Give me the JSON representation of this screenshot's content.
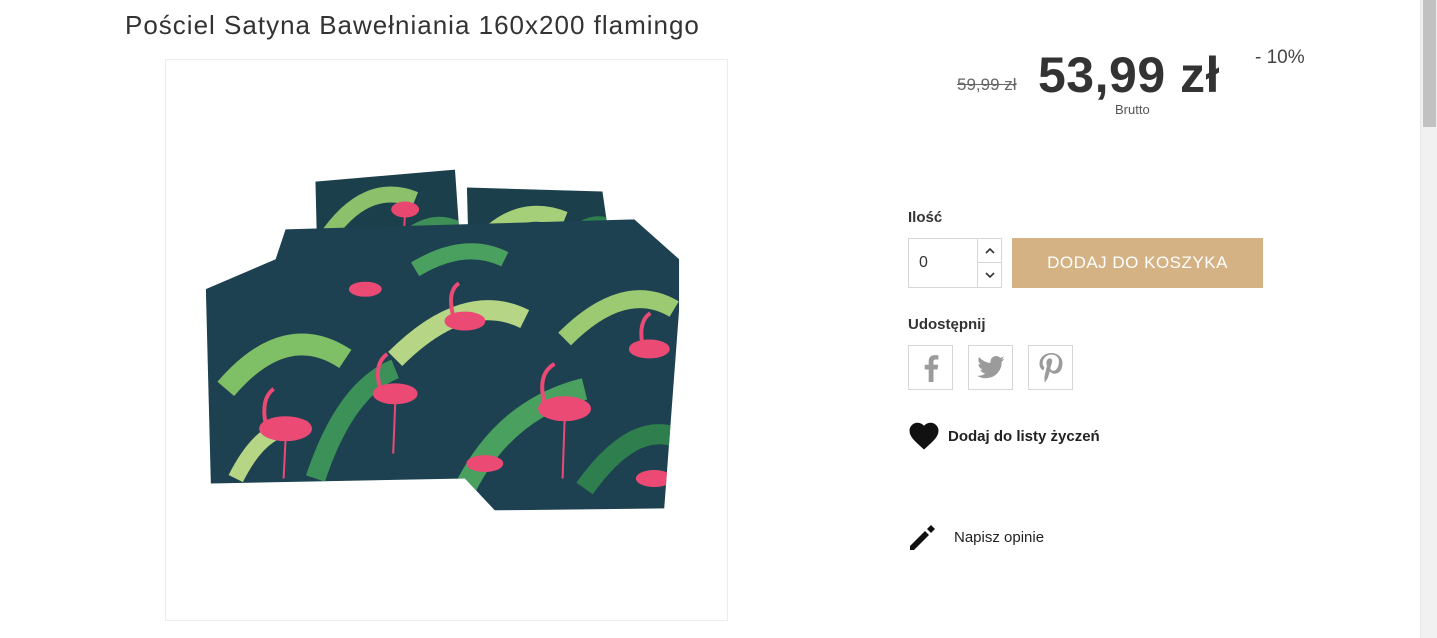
{
  "product": {
    "title": "Pościel Satyna Bawełniania 160x200 flamingo",
    "image_alt": "flamingo-bedding-photo"
  },
  "pricing": {
    "old_price": "59,99 zł",
    "price": "53,99 zł",
    "discount": "- 10%",
    "tax_label": "Brutto"
  },
  "quantity": {
    "label": "Ilość",
    "value": "0",
    "up_icon": "chevron-up-icon",
    "down_icon": "chevron-down-icon"
  },
  "cart": {
    "add_label": "DODAJ DO KOSZYKA",
    "accent_color": "#d4b284"
  },
  "share": {
    "label": "Udostępnij",
    "buttons": [
      "facebook-icon",
      "twitter-icon",
      "pinterest-icon"
    ]
  },
  "wishlist": {
    "label": "Dodaj do listy życzeń",
    "icon": "heart-icon"
  },
  "review": {
    "label": "Napisz opinie",
    "icon": "pencil-icon"
  }
}
